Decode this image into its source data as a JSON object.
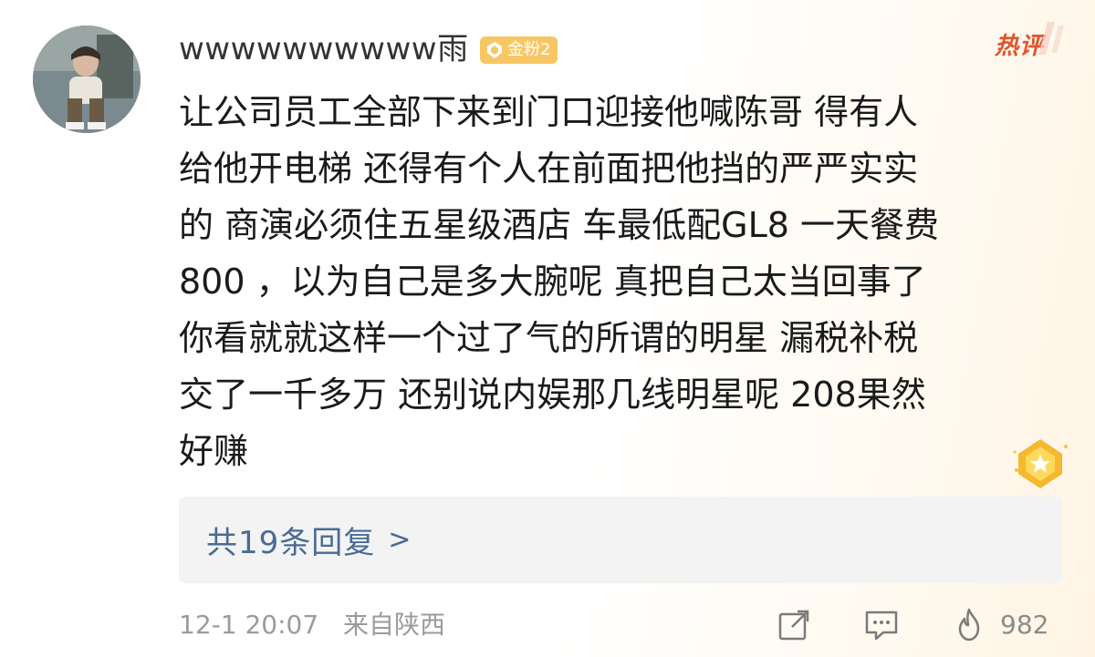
{
  "comment": {
    "username": "wwwwwwwwww雨",
    "badge": {
      "label": "金粉2",
      "color": "#f7c765",
      "icon": "fan-crest-icon"
    },
    "hot_tag": "热评",
    "hot_tag_color": "#e1532a",
    "lines": [
      "让公司员工全部下来到门口迎接他喊陈哥  得有人",
      "给他开电梯 还得有个人在前面把他挡的严严实实",
      "的  商演必须住五星级酒店 车最低配GL8 一天餐费",
      "800 ，以为自己是多大腕呢 真把自己太当回事了",
      "你看就就这样一个过了气的所谓的明星 漏税补税",
      "交了一千多万 还别说内娱那几线明星呢 208果然",
      "好赚"
    ],
    "replies": {
      "label": "共19条回复",
      "arrow": ">"
    },
    "footer": {
      "time": "12-1 20:07",
      "source": "来自陕西",
      "like_count": "982"
    },
    "icons": {
      "share": "share-icon",
      "reply": "comment-icon",
      "like": "like-flame-icon"
    },
    "colors": {
      "link": "#4a6b94",
      "meta": "#9b9b9b",
      "body": "#1a1a1a"
    }
  }
}
